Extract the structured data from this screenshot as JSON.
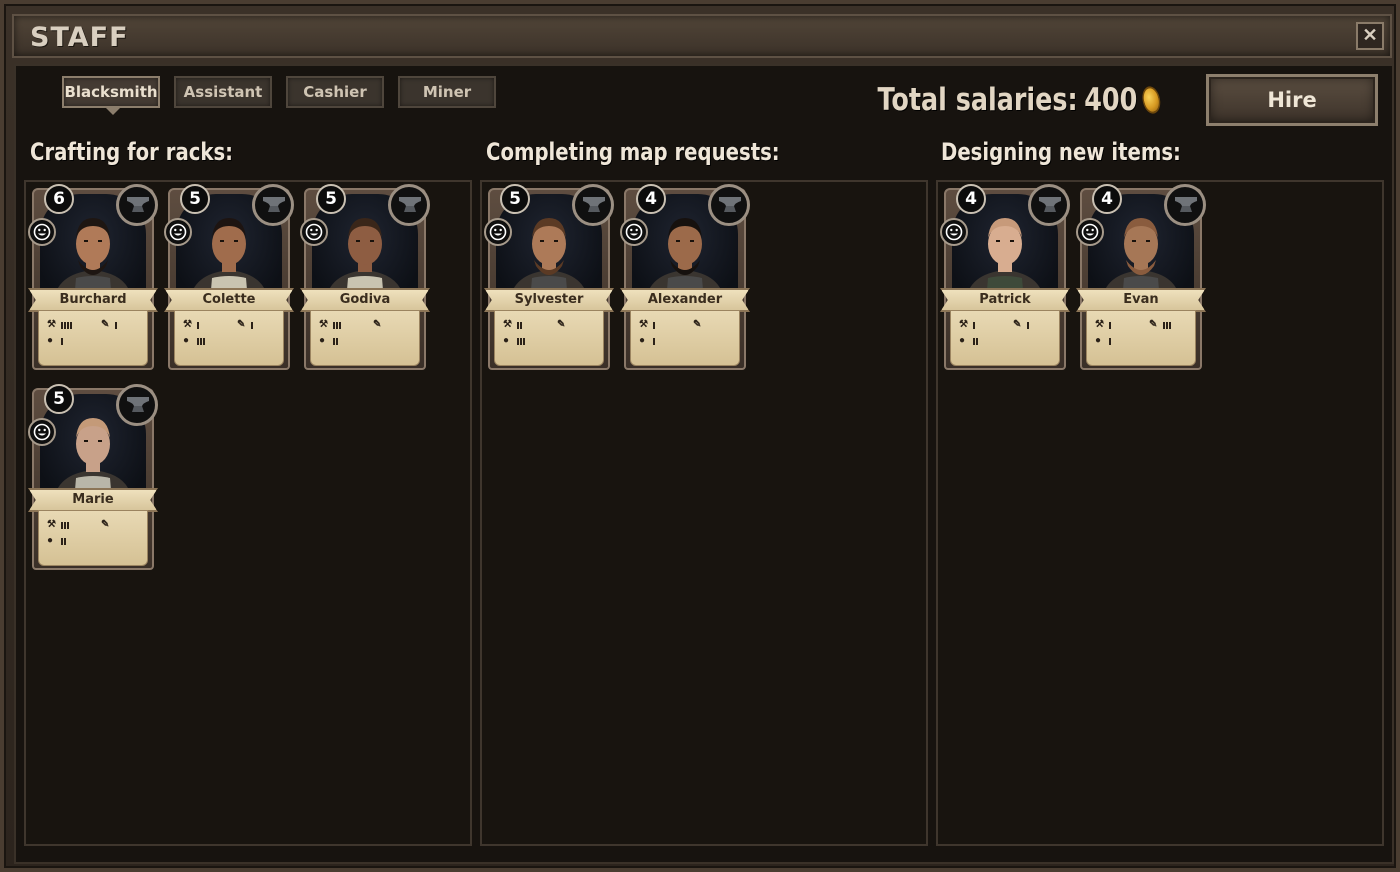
{
  "window": {
    "title": "STAFF",
    "close_label": "✕"
  },
  "tabs": [
    {
      "label": "Blacksmith",
      "active": true
    },
    {
      "label": "Assistant",
      "active": false
    },
    {
      "label": "Cashier",
      "active": false
    },
    {
      "label": "Miner",
      "active": false
    }
  ],
  "salaries": {
    "label": "Total salaries:",
    "value": "400",
    "icon": "coin-icon"
  },
  "hire_label": "Hire",
  "sections": [
    {
      "title": "Crafting for racks:"
    },
    {
      "title": "Completing map requests:"
    },
    {
      "title": "Designing new items:"
    }
  ],
  "workers": [
    {
      "name": "Burchard",
      "level": "6",
      "section": 0,
      "craft": 4,
      "design": 1,
      "idea": 1,
      "skin": "#b07a58",
      "hair": "#1e1612",
      "beard": true,
      "apron": "#4a4a4a"
    },
    {
      "name": "Colette",
      "level": "5",
      "section": 0,
      "craft": 1,
      "design": 1,
      "idea": 3,
      "skin": "#a06c4c",
      "hair": "#1d1411",
      "beard": false,
      "apron": "#c9c4b1"
    },
    {
      "name": "Godiva",
      "level": "5",
      "section": 0,
      "craft": 3,
      "design": 0,
      "idea": 2,
      "skin": "#8e5d42",
      "hair": "#3a2619",
      "beard": false,
      "apron": "#c9c4b1"
    },
    {
      "name": "Marie",
      "level": "5",
      "section": 0,
      "craft": 3,
      "design": 0,
      "idea": 2,
      "skin": "#c8a189",
      "hair": "#c49a78",
      "beard": false,
      "apron": "#b9b6a8"
    },
    {
      "name": "Sylvester",
      "level": "5",
      "section": 1,
      "craft": 2,
      "design": 0,
      "idea": 3,
      "skin": "#ad7a58",
      "hair": "#5b3a24",
      "beard": true,
      "apron": "#4a4a4a"
    },
    {
      "name": "Alexander",
      "level": "4",
      "section": 1,
      "craft": 1,
      "design": 0,
      "idea": 1,
      "skin": "#9c6a4a",
      "hair": "#16110e",
      "beard": true,
      "apron": "#4a4a4a"
    },
    {
      "name": "Patrick",
      "level": "4",
      "section": 2,
      "craft": 1,
      "design": 1,
      "idea": 2,
      "skin": "#d8ad90",
      "hair": "#c79a7a",
      "beard": false,
      "apron": "#3e4a3a"
    },
    {
      "name": "Evan",
      "level": "4",
      "section": 2,
      "craft": 1,
      "design": 3,
      "idea": 1,
      "skin": "#a67756",
      "hair": "#8a5c3e",
      "beard": true,
      "apron": "#4a4a4a"
    }
  ],
  "icons": {
    "level": "level-badge",
    "class": "anvil-icon",
    "mood": "happy-face-icon",
    "craft": "hammer-icon",
    "design": "quill-icon",
    "idea": "lightbulb-icon"
  },
  "colors": {
    "background": "#17130f",
    "card_paper": "#e8d9b4",
    "accent": "#8d7f6d"
  }
}
